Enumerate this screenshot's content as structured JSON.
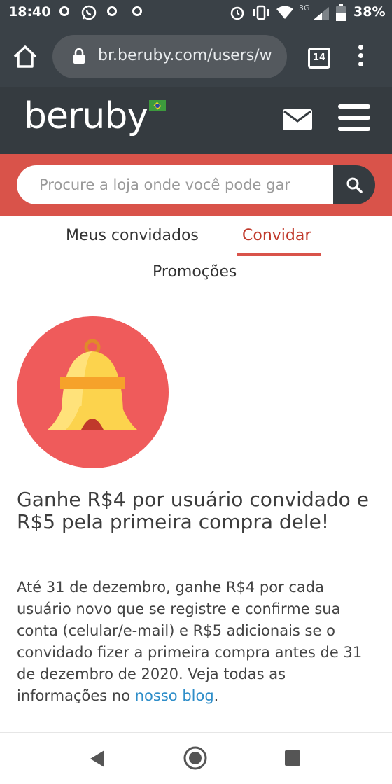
{
  "status_bar": {
    "time": "18:40",
    "network": "3G",
    "battery": "38%",
    "icons": [
      "notification-ring-icon",
      "whatsapp-icon",
      "notification-ring-icon",
      "notification-ring-icon",
      "alarm-icon",
      "vibrate-icon",
      "wifi-icon",
      "cell-signal-icon",
      "battery-icon"
    ]
  },
  "browser": {
    "url": "br.beruby.com/users/w",
    "tab_count": "14"
  },
  "header": {
    "logo_text": "beruby",
    "flag": "brazil-flag-icon"
  },
  "search": {
    "placeholder": "Procure a loja onde você pode gar"
  },
  "tabs": [
    {
      "label": "Meus convidados",
      "active": false
    },
    {
      "label": "Convidar",
      "active": true
    },
    {
      "label": "Promoções",
      "active": false
    }
  ],
  "promo": {
    "title": "Ganhe R$4 por usuário convidado e R$5 pela primeira compra dele!",
    "body_before_link": "Até 31 de dezembro, ganhe R$4 por cada usuário novo que se registre e confirme sua conta (celular/e-mail) e R$5 adicionais se o convidado fizer a primeira compra antes de 31 de dezembro de 2020. Veja todas as informações no ",
    "link_text": "nosso blog",
    "body_after_link": "."
  },
  "colors": {
    "header_bg": "#353b40",
    "accent_red": "#d9534a",
    "link_blue": "#2f8ec9",
    "bell_circle": "#ef5b5b"
  }
}
